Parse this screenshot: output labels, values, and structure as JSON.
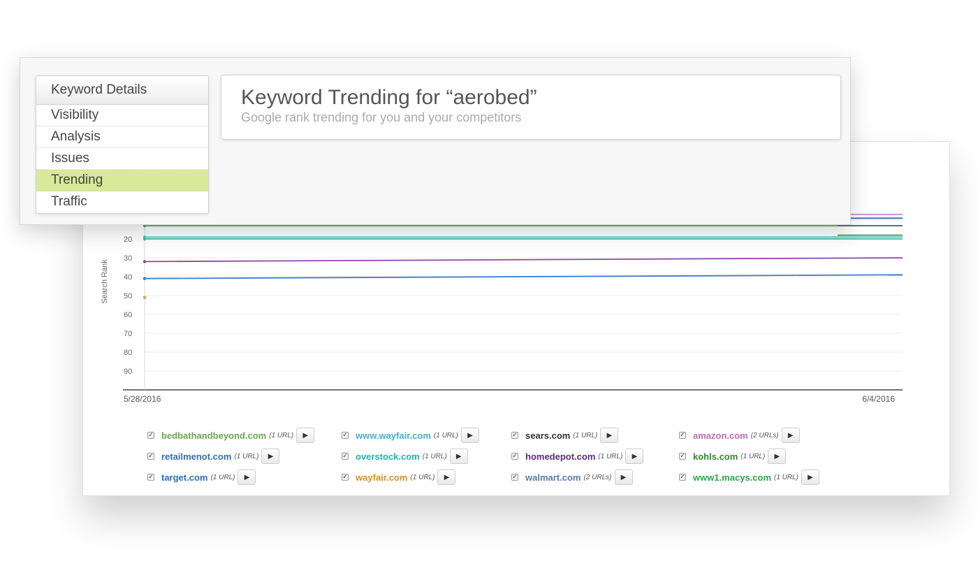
{
  "nav": {
    "header": "Keyword Details",
    "items": [
      {
        "label": "Visibility",
        "active": false
      },
      {
        "label": "Analysis",
        "active": false
      },
      {
        "label": "Issues",
        "active": false
      },
      {
        "label": "Trending",
        "active": true
      },
      {
        "label": "Traffic",
        "active": false
      }
    ],
    "active_color": "#d8ea99"
  },
  "header": {
    "title": "Keyword Trending for “aerobed”",
    "subtitle": "Google rank trending for you and your competitors"
  },
  "chart_data": {
    "type": "line",
    "ylabel": "Search Rank",
    "y_ticks": [
      "20",
      "30",
      "40",
      "50",
      "60",
      "70",
      "80",
      "90"
    ],
    "y_inverted": true,
    "x_labels": [
      "5/28/2016",
      "6/4/2016"
    ],
    "grid": true,
    "series": [
      {
        "name": "bedbathandbeyond.com",
        "color": "#4caf50",
        "start": 13,
        "end": 13
      },
      {
        "name": "www.wayfair.com",
        "color": "#5bc0c8",
        "start": 19,
        "end": 19
      },
      {
        "name": "overstock.com",
        "color": "#2ec4a8",
        "start": 20,
        "end": 20
      },
      {
        "name": "homedepot.com",
        "color": "#8e44ad",
        "start": 32,
        "end": 30
      },
      {
        "name": "target.com",
        "color": "#3d7fd1",
        "start": 41,
        "end": 39
      },
      {
        "name": "wayfair.com",
        "color": "#e0a030",
        "start": 51,
        "end": null
      },
      {
        "name": "amazon.com",
        "color": "#cc88cc",
        "start": null,
        "end": 7
      },
      {
        "name": "retailmenot.com",
        "color": "#2e6fb5",
        "start": null,
        "end": 9
      },
      {
        "name": "sears.com",
        "color": "#555f6e",
        "start": null,
        "end": 13
      },
      {
        "name": "kohls.com",
        "color": "#3a9a3a",
        "start": null,
        "end": 18
      }
    ]
  },
  "legend": [
    {
      "site": "bedbathandbeyond.com",
      "urls": "(1 URL)",
      "color": "#6aa84f"
    },
    {
      "site": "www.wayfair.com",
      "urls": "(1 URL)",
      "color": "#45b0c8"
    },
    {
      "site": "sears.com",
      "urls": "(1 URL)",
      "color": "#333333"
    },
    {
      "site": "amazon.com",
      "urls": "(2 URLs)",
      "color": "#c06bb5"
    },
    {
      "site": "retailmenot.com",
      "urls": "(1 URL)",
      "color": "#2e6fb5"
    },
    {
      "site": "overstock.com",
      "urls": "(1 URL)",
      "color": "#1bb5b0"
    },
    {
      "site": "homedepot.com",
      "urls": "(1 URL)",
      "color": "#5b2a7a"
    },
    {
      "site": "kohls.com",
      "urls": "(1 URL)",
      "color": "#2a8a2a"
    },
    {
      "site": "target.com",
      "urls": "(1 URL)",
      "color": "#2a6fc0"
    },
    {
      "site": "wayfair.com",
      "urls": "(1 URL)",
      "color": "#d99020"
    },
    {
      "site": "walmart.com",
      "urls": "(2 URLs)",
      "color": "#5a7aa8"
    },
    {
      "site": "www1.macys.com",
      "urls": "(1 URL)",
      "color": "#27a84a"
    }
  ],
  "icons": {
    "checkbox": "checkbox-checked-icon",
    "play": "play-icon"
  }
}
